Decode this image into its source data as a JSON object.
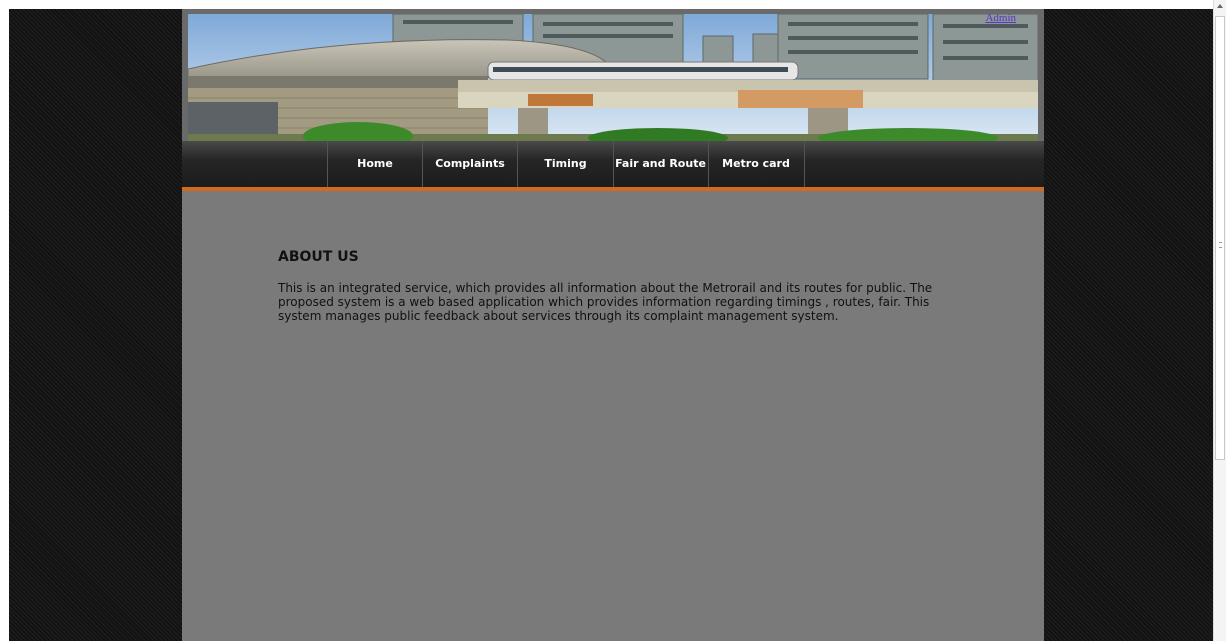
{
  "header": {
    "admin_link": "Admin"
  },
  "nav": {
    "items": [
      {
        "label": "Home"
      },
      {
        "label": "Complaints"
      },
      {
        "label": "Timing"
      },
      {
        "label": "Fair and Route"
      },
      {
        "label": "Metro card"
      }
    ]
  },
  "about": {
    "heading": "ABOUT US",
    "body": "This is an integrated service, which provides all information about the Metrorail and its routes for public. The proposed system is a web based application which provides information regarding timings , routes, fair. This system manages public feedback about services through its complaint management system."
  },
  "colors": {
    "page_background": "#141414",
    "panel": "#7a7a7a",
    "nav_bar": "#1c1c1c",
    "nav_accent": "#d2691e",
    "link": "#5533cc"
  },
  "icons": {
    "banner": "metro-station-image"
  }
}
